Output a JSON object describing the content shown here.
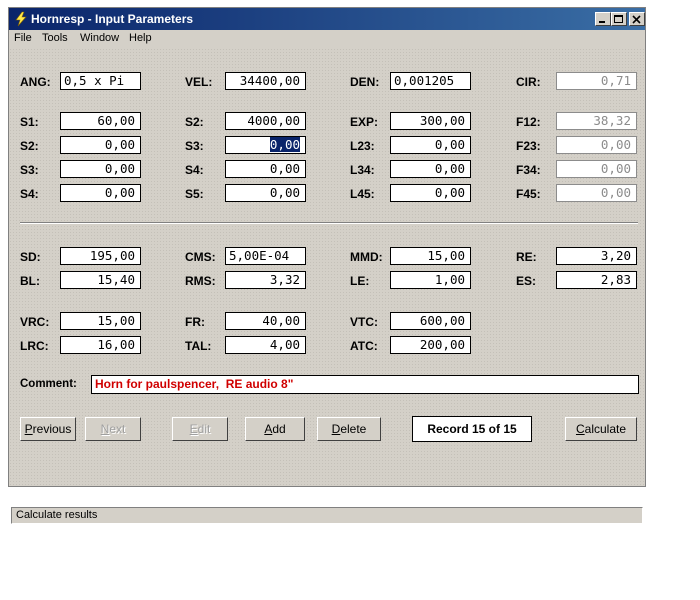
{
  "window": {
    "title": "Hornresp - Input Parameters",
    "title_color": "#0a246a"
  },
  "menu": [
    "File",
    "Tools",
    "Window",
    "Help"
  ],
  "params": {
    "ANG": {
      "label": "ANG:",
      "value": "0,5 x Pi"
    },
    "VEL": {
      "label": "VEL:",
      "value": "34400,00"
    },
    "DEN": {
      "label": "DEN:",
      "value": "0,001205"
    },
    "CIR": {
      "label": "CIR:",
      "value": "0,71",
      "enabled": false
    },
    "S1": {
      "label": "S1:",
      "value": "60,00"
    },
    "S2a": {
      "label": "S2:",
      "value": "4000,00"
    },
    "EXP": {
      "label": "EXP:",
      "value": "300,00"
    },
    "F12": {
      "label": "F12:",
      "value": "38,32",
      "enabled": false
    },
    "S2b": {
      "label": "S2:",
      "value": "0,00"
    },
    "S3a": {
      "label": "S3:",
      "value": "0,00",
      "selected": true
    },
    "L23": {
      "label": "L23:",
      "value": "0,00"
    },
    "F23": {
      "label": "F23:",
      "value": "0,00",
      "enabled": false
    },
    "S3b": {
      "label": "S3:",
      "value": "0,00"
    },
    "S4a": {
      "label": "S4:",
      "value": "0,00"
    },
    "L34": {
      "label": "L34:",
      "value": "0,00"
    },
    "F34": {
      "label": "F34:",
      "value": "0,00",
      "enabled": false
    },
    "S4b": {
      "label": "S4:",
      "value": "0,00"
    },
    "S5": {
      "label": "S5:",
      "value": "0,00"
    },
    "L45": {
      "label": "L45:",
      "value": "0,00"
    },
    "F45": {
      "label": "F45:",
      "value": "0,00",
      "enabled": false
    },
    "SD": {
      "label": "SD:",
      "value": "195,00"
    },
    "CMS": {
      "label": "CMS:",
      "value": "5,00E-04"
    },
    "MMD": {
      "label": "MMD:",
      "value": "15,00"
    },
    "RE": {
      "label": "RE:",
      "value": "3,20"
    },
    "BL": {
      "label": "BL:",
      "value": "15,40"
    },
    "RMS": {
      "label": "RMS:",
      "value": "3,32"
    },
    "LE": {
      "label": "LE:",
      "value": "1,00"
    },
    "ES": {
      "label": "ES:",
      "value": "2,83"
    },
    "VRC": {
      "label": "VRC:",
      "value": "15,00"
    },
    "FR": {
      "label": "FR:",
      "value": "40,00"
    },
    "VTC": {
      "label": "VTC:",
      "value": "600,00"
    },
    "LRC": {
      "label": "LRC:",
      "value": "16,00"
    },
    "TAL": {
      "label": "TAL:",
      "value": "4,00"
    },
    "ATC": {
      "label": "ATC:",
      "value": "200,00"
    }
  },
  "comment": {
    "label": "Comment:",
    "value": "Horn for paulspencer,  RE audio 8\"",
    "text_color": "#d00000"
  },
  "buttons": {
    "previous": {
      "first": "P",
      "rest": "revious",
      "enabled": true
    },
    "next": {
      "first": "N",
      "rest": "ext",
      "enabled": false
    },
    "edit": {
      "first": "E",
      "rest": "dit",
      "enabled": false
    },
    "add": {
      "first": "A",
      "rest": "dd",
      "enabled": true
    },
    "delete": {
      "first": "D",
      "rest": "elete",
      "enabled": true
    },
    "calculate": {
      "first": "C",
      "rest": "alculate",
      "enabled": true
    }
  },
  "record": "Record 15 of 15",
  "status": "Calculate results"
}
